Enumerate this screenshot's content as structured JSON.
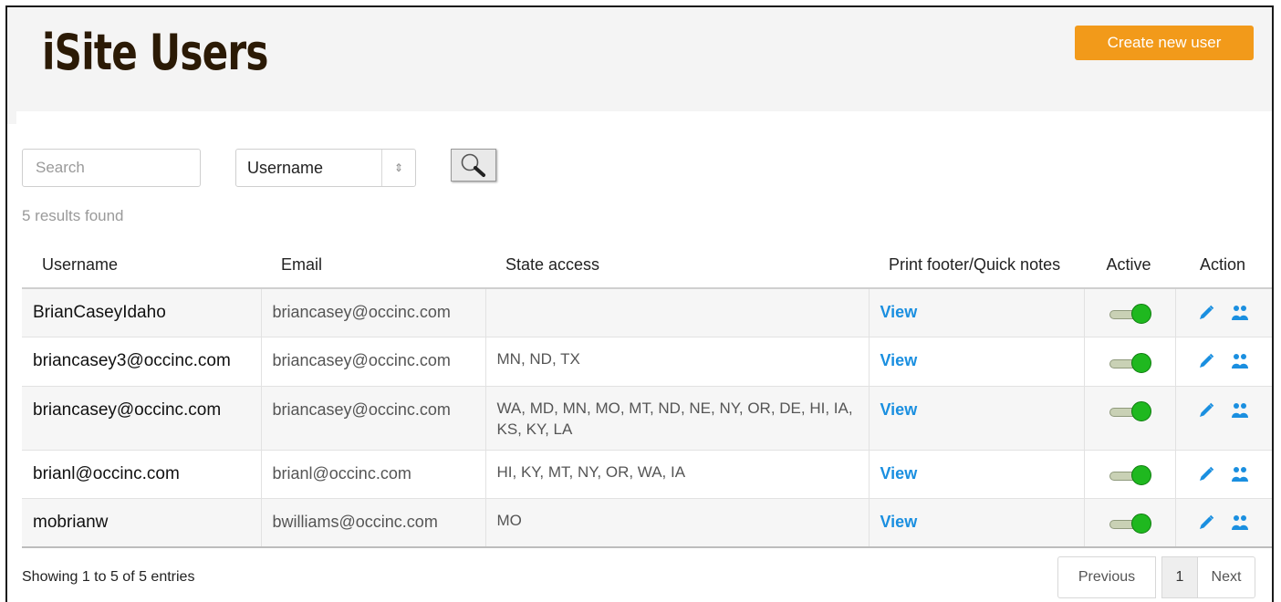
{
  "header": {
    "title": "iSite Users",
    "create_button": "Create new user"
  },
  "search": {
    "placeholder": "Search",
    "field_select": "Username",
    "results_text": "5 results found",
    "icon": "magnifier-icon"
  },
  "table": {
    "columns": {
      "username": "Username",
      "email": "Email",
      "state": "State access",
      "notes": "Print footer/Quick notes",
      "active": "Active",
      "action": "Action"
    },
    "rows": [
      {
        "username": "BrianCaseyIdaho",
        "email": "briancasey@occinc.com",
        "state": "",
        "view": "View",
        "active": true
      },
      {
        "username": "briancasey3@occinc.com",
        "email": "briancasey@occinc.com",
        "state": "MN, ND, TX",
        "view": "View",
        "active": true
      },
      {
        "username": "briancasey@occinc.com",
        "email": "briancasey@occinc.com",
        "state": "WA, MD, MN, MO, MT, ND, NE, NY, OR, DE, HI, IA, KS, KY, LA",
        "view": "View",
        "active": true
      },
      {
        "username": "brianl@occinc.com",
        "email": "brianl@occinc.com",
        "state": "HI, KY, MT, NY, OR, WA, IA",
        "view": "View",
        "active": true
      },
      {
        "username": "mobrianw",
        "email": "bwilliams@occinc.com",
        "state": "MO",
        "view": "View",
        "active": true
      }
    ]
  },
  "footer": {
    "info": "Showing 1 to 5 of 5 entries",
    "previous": "Previous",
    "page": "1",
    "next": "Next"
  },
  "colors": {
    "accent": "#f29a1a",
    "link": "#1a8fe0",
    "toggle_on": "#1fb81f",
    "title": "#2b1a05"
  }
}
